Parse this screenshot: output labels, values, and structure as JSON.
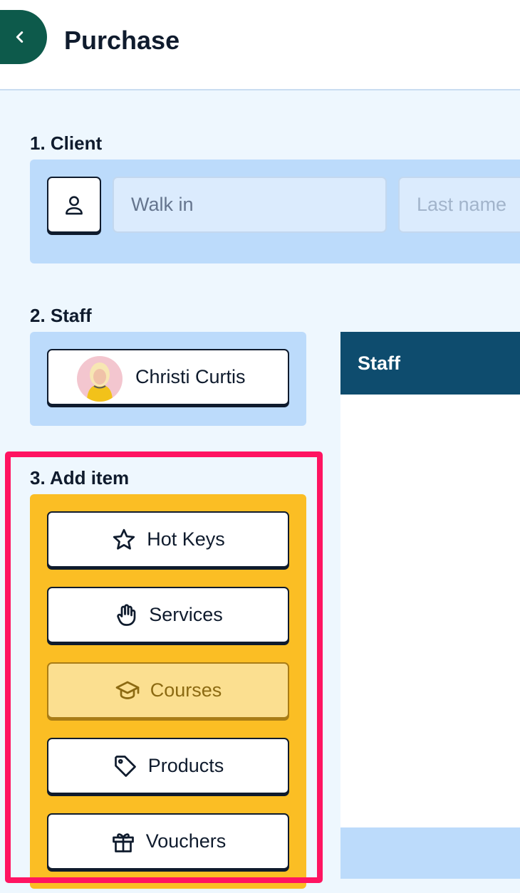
{
  "header": {
    "title": "Purchase",
    "back_icon": "chevron-left-icon"
  },
  "client": {
    "label": "1. Client",
    "icon": "user-icon",
    "first_name_value": "Walk in",
    "last_name_placeholder": "Last name"
  },
  "staff": {
    "label": "2. Staff",
    "selected_name": "Christi Curtis",
    "list_header": "Staff"
  },
  "add_item": {
    "label": "3. Add item",
    "items": [
      {
        "label": "Hot Keys",
        "icon": "star-icon",
        "active": false
      },
      {
        "label": "Services",
        "icon": "hand-icon",
        "active": false
      },
      {
        "label": "Courses",
        "icon": "graduation-cap-icon",
        "active": true
      },
      {
        "label": "Products",
        "icon": "tag-icon",
        "active": false
      },
      {
        "label": "Vouchers",
        "icon": "gift-icon",
        "active": false
      }
    ]
  },
  "colors": {
    "brand_green": "#0d5a4b",
    "panel_blue": "#bcdbfb",
    "staff_header": "#0e4c6e",
    "item_panel": "#fbbe24",
    "highlight": "#ff1461"
  }
}
